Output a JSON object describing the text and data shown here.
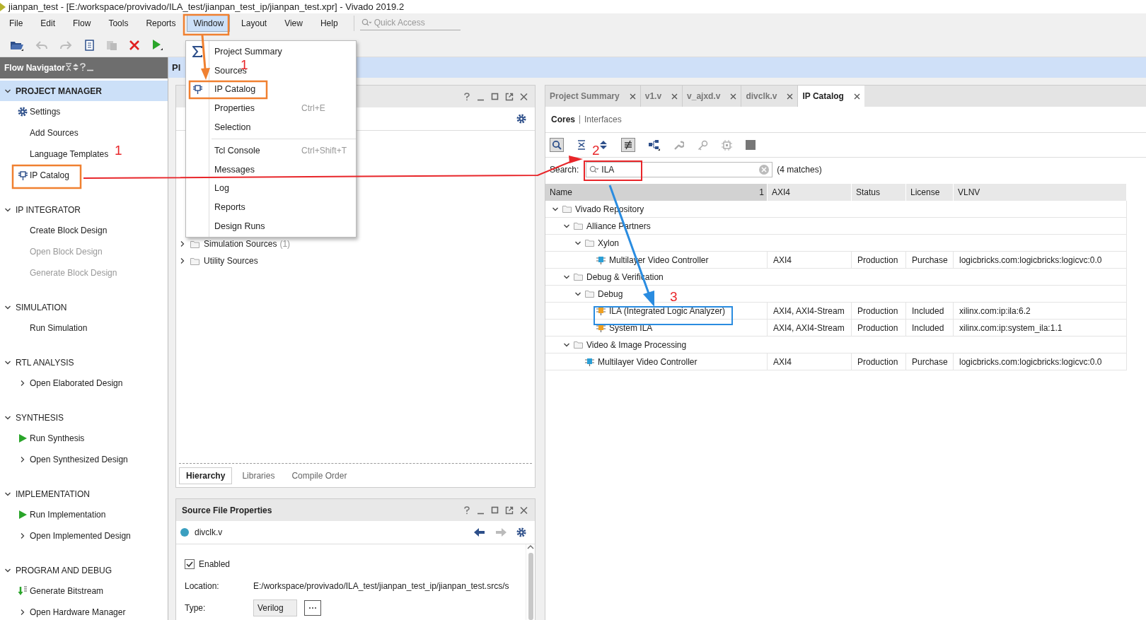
{
  "title_bar": {
    "title": "jianpan_test - [E:/workspace/provivado/ILA_test/jianpan_test_ip/jianpan_test.xpr] - Vivado 2019.2"
  },
  "menu_bar": {
    "items": [
      {
        "label": "File",
        "selected": false
      },
      {
        "label": "Edit",
        "selected": false
      },
      {
        "label": "Flow",
        "selected": false
      },
      {
        "label": "Tools",
        "selected": false
      },
      {
        "label": "Reports",
        "selected": false
      },
      {
        "label": "Window",
        "selected": true
      },
      {
        "label": "Layout",
        "selected": false
      },
      {
        "label": "View",
        "selected": false
      },
      {
        "label": "Help",
        "selected": false
      }
    ],
    "quick_access": {
      "placeholder": "Quick Access"
    }
  },
  "flow_navigator": {
    "title": "Flow Navigator",
    "sections": [
      {
        "title": "PROJECT MANAGER",
        "selected": true,
        "expanded": true,
        "items": [
          {
            "label": "Settings",
            "kind": "gear",
            "disabled": false
          },
          {
            "label": "Add Sources",
            "kind": "plain",
            "disabled": false
          },
          {
            "label": "Language Templates",
            "kind": "plain",
            "disabled": false
          },
          {
            "label": "IP Catalog",
            "kind": "ip",
            "disabled": false
          }
        ]
      },
      {
        "title": "IP INTEGRATOR",
        "selected": false,
        "expanded": true,
        "items": [
          {
            "label": "Create Block Design",
            "kind": "plain",
            "disabled": false
          },
          {
            "label": "Open Block Design",
            "kind": "plain",
            "disabled": true
          },
          {
            "label": "Generate Block Design",
            "kind": "plain",
            "disabled": true
          }
        ]
      },
      {
        "title": "SIMULATION",
        "selected": false,
        "expanded": true,
        "items": [
          {
            "label": "Run Simulation",
            "kind": "plain",
            "disabled": false
          }
        ]
      },
      {
        "title": "RTL ANALYSIS",
        "selected": false,
        "expanded": true,
        "items": [
          {
            "label": "Open Elaborated Design",
            "kind": "expand",
            "disabled": false
          }
        ]
      },
      {
        "title": "SYNTHESIS",
        "selected": false,
        "expanded": true,
        "items": [
          {
            "label": "Run Synthesis",
            "kind": "run",
            "disabled": false
          },
          {
            "label": "Open Synthesized Design",
            "kind": "expand",
            "disabled": false
          }
        ]
      },
      {
        "title": "IMPLEMENTATION",
        "selected": false,
        "expanded": true,
        "items": [
          {
            "label": "Run Implementation",
            "kind": "run",
            "disabled": false
          },
          {
            "label": "Open Implemented Design",
            "kind": "expand",
            "disabled": false
          }
        ]
      },
      {
        "title": "PROGRAM AND DEBUG",
        "selected": false,
        "expanded": true,
        "items": [
          {
            "label": "Generate Bitstream",
            "kind": "bitstream",
            "disabled": false
          },
          {
            "label": "Open Hardware Manager",
            "kind": "expand",
            "disabled": false
          }
        ]
      }
    ]
  },
  "project_bar": {
    "title": "Pl"
  },
  "window_menu": {
    "groups": [
      [
        {
          "label": "Project Summary",
          "kind": "sigma"
        },
        {
          "label": "Sources",
          "kind": "plain"
        },
        {
          "label": "IP Catalog",
          "kind": "ip"
        },
        {
          "label": "Properties",
          "kind": "plain",
          "shortcut": "Ctrl+E"
        },
        {
          "label": "Selection",
          "kind": "plain"
        }
      ],
      [
        {
          "label": "Tcl Console",
          "kind": "plain",
          "shortcut": "Ctrl+Shift+T"
        },
        {
          "label": "Messages",
          "kind": "plain"
        },
        {
          "label": "Log",
          "kind": "plain"
        },
        {
          "label": "Reports",
          "kind": "plain"
        },
        {
          "label": "Design Runs",
          "kind": "plain"
        }
      ]
    ]
  },
  "sources_panel": {
    "tree": [
      {
        "label": "Simulation Sources",
        "count": "(1)",
        "expanded": false
      },
      {
        "label": "Utility Sources",
        "expanded": false
      }
    ],
    "tabs": [
      {
        "label": "Hierarchy",
        "selected": true
      },
      {
        "label": "Libraries",
        "selected": false
      },
      {
        "label": "Compile Order",
        "selected": false
      }
    ]
  },
  "properties_panel": {
    "title": "Source File Properties",
    "file": "divclk.v",
    "enabled": {
      "label": "Enabled",
      "checked": true
    },
    "fields": [
      {
        "label": "Location:",
        "kind": "text",
        "value": "E:/workspace/provivado/ILA_test/jianpan_test_ip/jianpan_test.srcs/s"
      },
      {
        "label": "Type:",
        "kind": "dropdown",
        "value": "Verilog",
        "button": "⋯"
      }
    ]
  },
  "editor": {
    "tabs": [
      {
        "label": "Project Summary",
        "selected": false
      },
      {
        "label": "v1.v",
        "selected": false
      },
      {
        "label": "v_ajxd.v",
        "selected": false
      },
      {
        "label": "divclk.v",
        "selected": false
      },
      {
        "label": "IP Catalog",
        "selected": true
      }
    ],
    "subtabs": [
      {
        "label": "Cores",
        "selected": true
      },
      {
        "label": "Interfaces",
        "selected": false
      }
    ],
    "search": {
      "label": "Search:",
      "value": "ILA",
      "matches": "(4 matches)"
    },
    "table": {
      "columns": [
        {
          "label": "Name",
          "sort": "1"
        },
        {
          "label": "AXI4"
        },
        {
          "label": "Status"
        },
        {
          "label": "License"
        },
        {
          "label": "VLNV"
        }
      ],
      "rows": [
        {
          "name": "Vivado Repository",
          "kind": "folder",
          "expanded": true,
          "children": [
            {
              "name": "Alliance Partners",
              "kind": "folder",
              "expanded": true,
              "children": [
                {
                  "name": "Xylon",
                  "kind": "folder",
                  "expanded": true,
                  "children": [
                    {
                      "name": "Multilayer Video Controller",
                      "kind": "ip",
                      "color": "#2a9fd6",
                      "cells": [
                        "AXI4",
                        "Production",
                        "Purchase",
                        "logicbricks.com:logicbricks:logicvc:0.0"
                      ]
                    }
                  ]
                }
              ]
            },
            {
              "name": "Debug & Verification",
              "kind": "folder",
              "expanded": true,
              "children": [
                {
                  "name": "Debug",
                  "kind": "folder",
                  "expanded": true,
                  "children": [
                    {
                      "name": "ILA (Integrated Logic Analyzer)",
                      "kind": "ip",
                      "color": "#f0a020",
                      "cells": [
                        "AXI4, AXI4-Stream",
                        "Production",
                        "Included",
                        "xilinx.com:ip:ila:6.2"
                      ]
                    },
                    {
                      "name": "System ILA",
                      "kind": "ip",
                      "color": "#f0a020",
                      "cells": [
                        "AXI4, AXI4-Stream",
                        "Production",
                        "Included",
                        "xilinx.com:ip:system_ila:1.1"
                      ]
                    }
                  ]
                }
              ]
            },
            {
              "name": "Video & Image Processing",
              "kind": "folder",
              "expanded": true,
              "children": [
                {
                  "name": "Multilayer Video Controller",
                  "kind": "ip",
                  "color": "#2a9fd6",
                  "cells": [
                    "AXI4",
                    "Production",
                    "Purchase",
                    "logicbricks.com:logicbricks:logicvc:0.0"
                  ]
                }
              ]
            }
          ]
        }
      ]
    }
  },
  "annotations": {
    "numbers": [
      {
        "label": "1"
      },
      {
        "label": "1"
      },
      {
        "label": "2"
      },
      {
        "label": "3"
      }
    ]
  }
}
